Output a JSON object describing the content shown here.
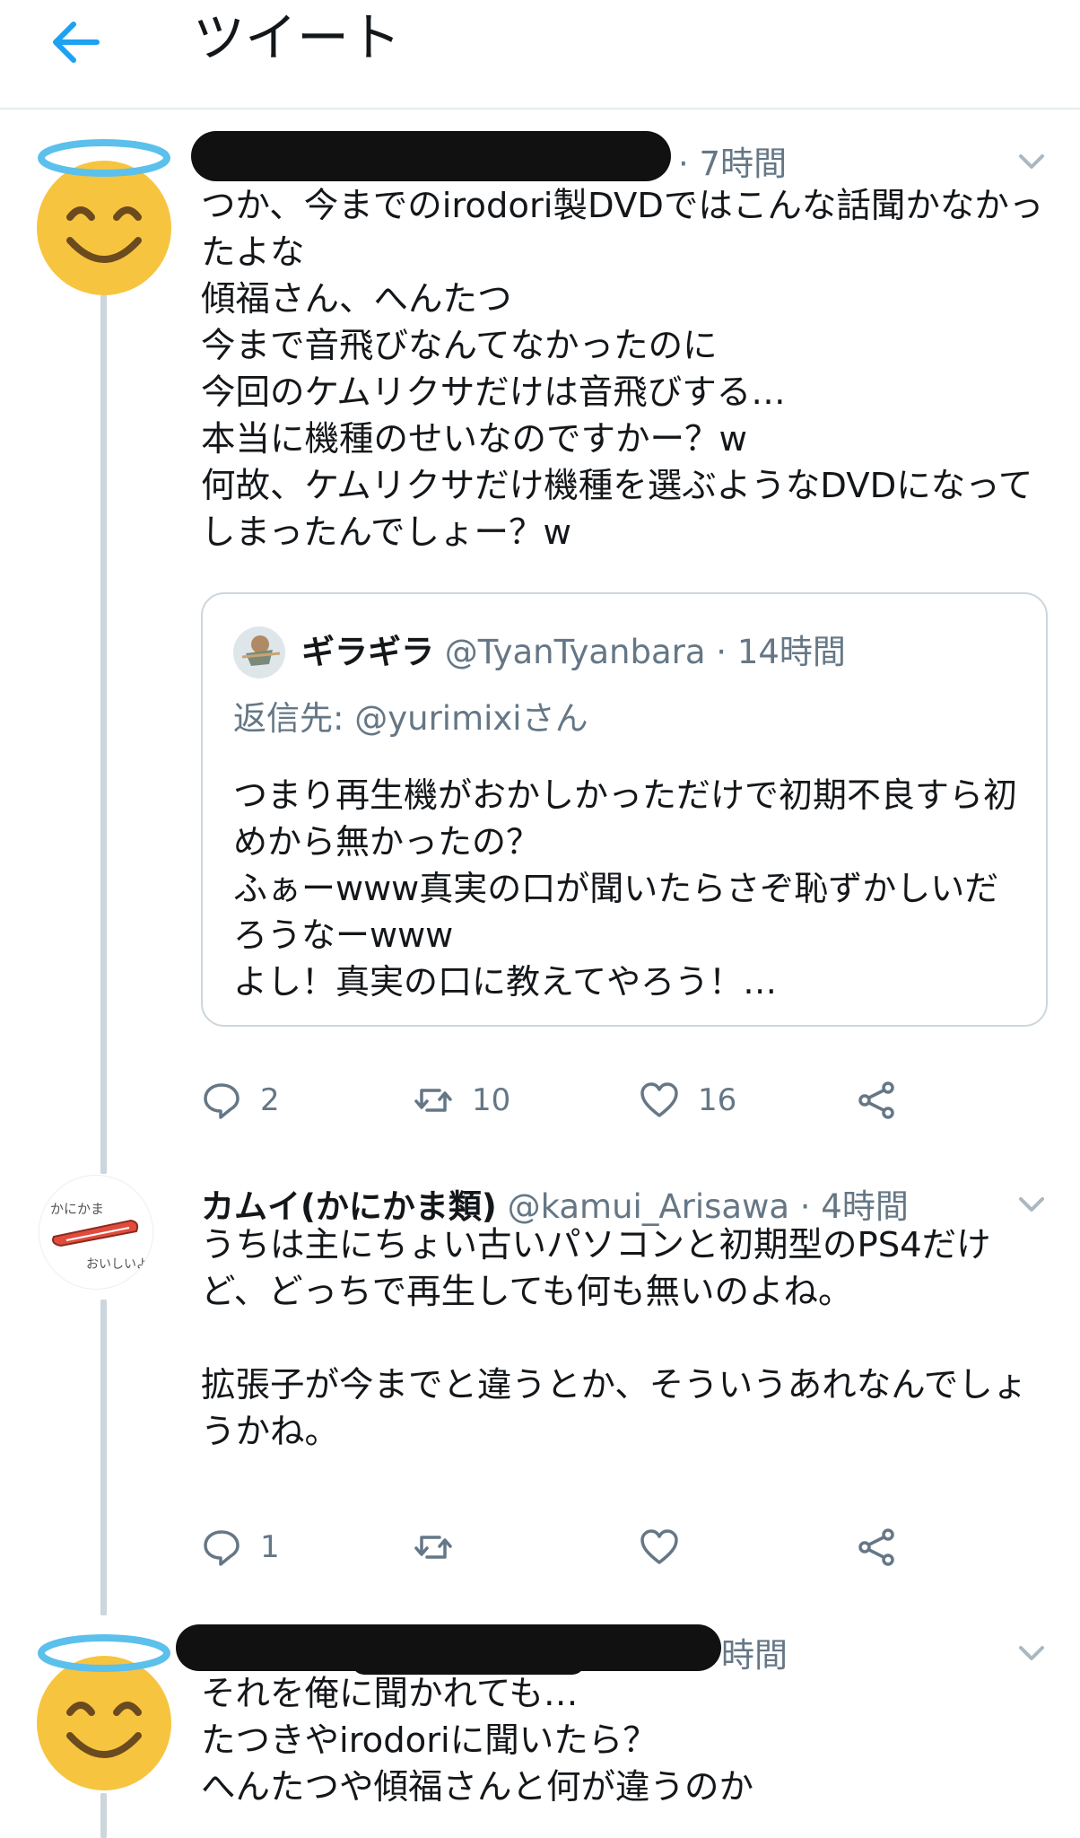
{
  "header": {
    "title": "ツイート"
  },
  "tweets": [
    {
      "time": "· 7時間",
      "text": "つか、今までのirodori製DVDではこんな話聞かなかったよな\n傾福さん、へんたつ\n今まで音飛びなんてなかったのに\n今回のケムリクサだけは音飛びする…\n本当に機種のせいなのですかー？w\n何故、ケムリクサだけ機種を選ぶようなDVDになってしまったんでしょー？w",
      "quote": {
        "name": "ギラギラ",
        "handle": "@TyanTyanbara",
        "time": "· 14時間",
        "reply_prefix": "返信先: ",
        "reply_mention": "@yurimixiさん",
        "text": "つまり再生機がおかしかっただけで初期不良すら初めから無かったの？\nふぁーwww真実の口が聞いたらさぞ恥ずかしいだろうなーwww\nよし！真実の口に教えてやろう！…"
      },
      "replies": "2",
      "retweets": "10",
      "likes": "16"
    },
    {
      "name": "カムイ(かにかま類)",
      "handle": "@kamui_Arisawa",
      "time": "· 4時間",
      "avatar_text_top": "かにかま",
      "avatar_text_bottom": "おいしいよ",
      "text": "うちは主にちょい古いパソコンと初期型のPS4だけど、どっちで再生しても何も無いのよね。\n\n拡張子が今までと違うとか、そういうあれなんでしょうかね。",
      "replies": "1",
      "retweets": "",
      "likes": ""
    },
    {
      "time": "時間",
      "text": "それを俺に聞かれても…\nたつきやirodoriに聞いたら？\nへんたつや傾福さんと何が違うのか"
    }
  ],
  "colors": {
    "accent": "#1da1f2",
    "secondary": "#657786",
    "line": "#ccd6dd",
    "halo": "#5bc0eb",
    "emoji": "#f7c43f"
  }
}
